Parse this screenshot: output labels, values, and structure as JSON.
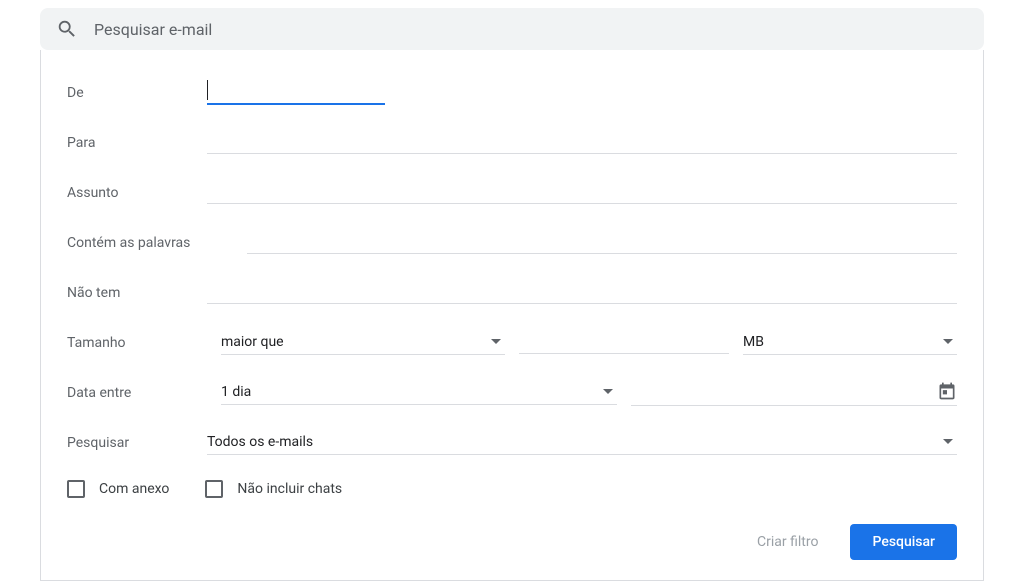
{
  "search": {
    "placeholder": "Pesquisar e-mail"
  },
  "labels": {
    "from": "De",
    "to": "Para",
    "subject": "Assunto",
    "has_words": "Contém as palavras",
    "doesnt_have": "Não tem",
    "size": "Tamanho",
    "date_within": "Data entre",
    "search_in": "Pesquisar"
  },
  "size": {
    "comparator": "maior que",
    "value": "",
    "unit": "MB"
  },
  "date": {
    "range": "1 dia",
    "picked": ""
  },
  "search_in": {
    "value": "Todos os e-mails"
  },
  "checkboxes": {
    "has_attachment": "Com anexo",
    "exclude_chats": "Não incluir chats"
  },
  "buttons": {
    "create_filter": "Criar filtro",
    "search": "Pesquisar"
  },
  "values": {
    "from": "",
    "to": "",
    "subject": "",
    "has_words": "",
    "doesnt_have": ""
  }
}
